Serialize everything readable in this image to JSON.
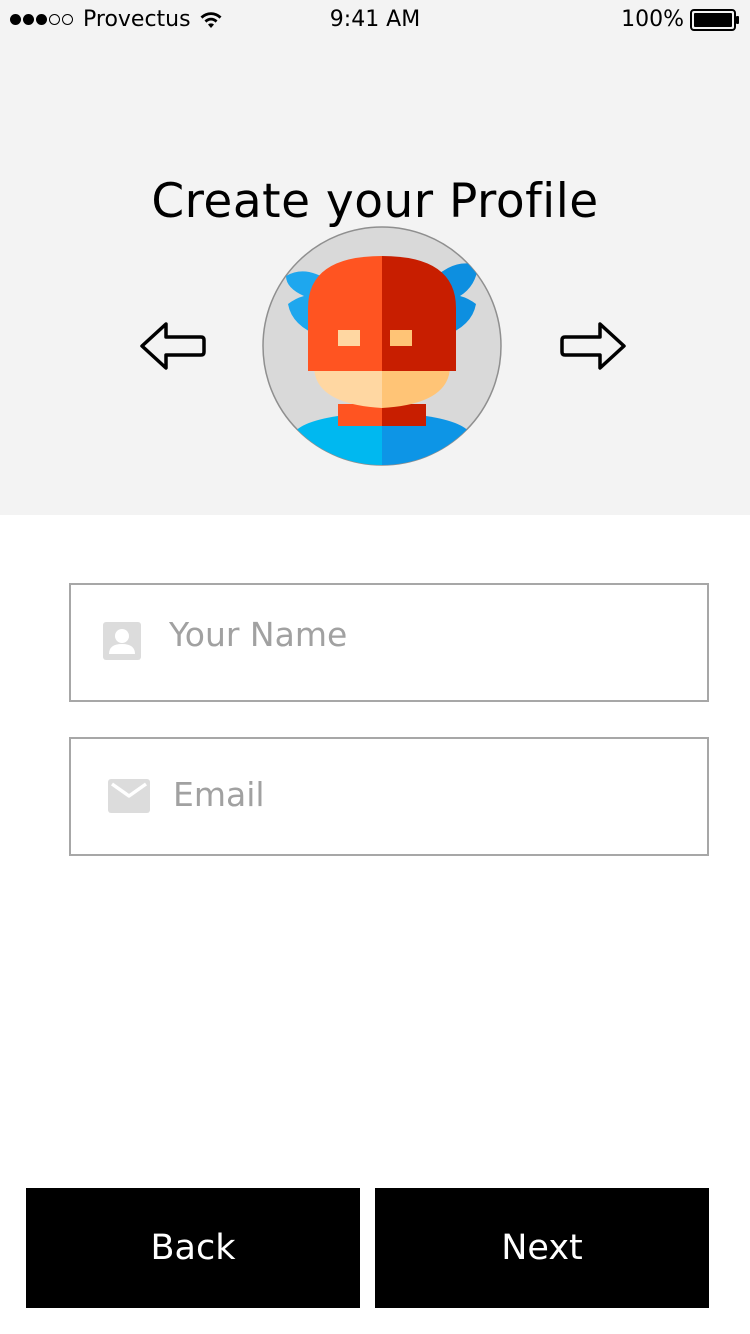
{
  "status_bar": {
    "signal_full": 3,
    "signal_empty": 2,
    "carrier": "Provectus",
    "time": "9:41 AM",
    "battery": "100%"
  },
  "header": {
    "title": "Create your Profile",
    "prev_icon": "arrow-left-icon",
    "next_icon": "arrow-right-icon"
  },
  "avatar": {
    "icon": "superhero-avatar",
    "colors": {
      "background": "#d9d9d9",
      "helmet_left": "#ff5421",
      "helmet_right": "#c81e00",
      "wings_left": "#1ea7ee",
      "wings_right": "#0d8fe0",
      "face_left": "#ffd7a2",
      "face_right": "#ffc476",
      "body_left": "#00b8f0",
      "body_right": "#0d95e6"
    }
  },
  "form": {
    "name_field": {
      "icon": "contact-icon",
      "placeholder": "Your Name",
      "value": ""
    },
    "email_field": {
      "icon": "mail-icon",
      "placeholder": "Email",
      "value": ""
    }
  },
  "actions": {
    "back_label": "Back",
    "next_label": "Next"
  }
}
